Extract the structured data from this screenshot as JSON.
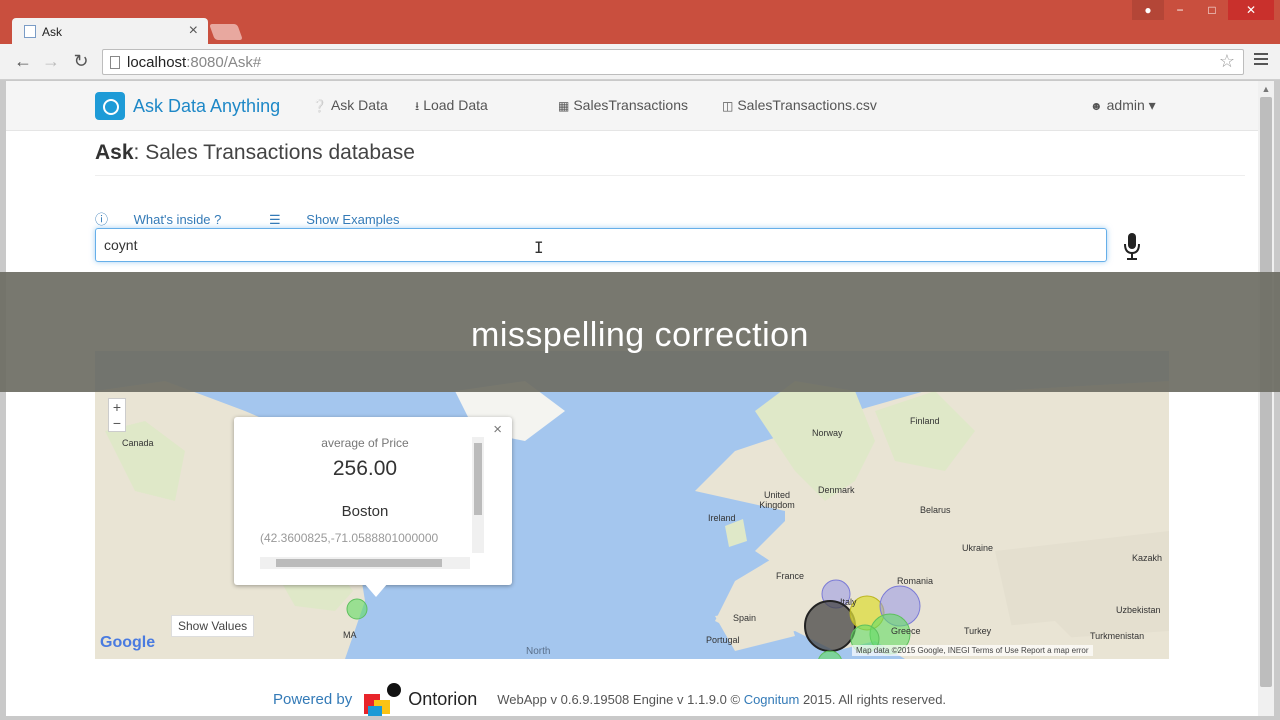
{
  "browser": {
    "tab_title": "Ask",
    "url_host": "localhost",
    "url_rest": ":8080/Ask#",
    "window_buttons": [
      "−",
      "□",
      "✕"
    ]
  },
  "app": {
    "brand": "Ask Data Anything",
    "nav": {
      "ask_data": "Ask Data",
      "load_data": "Load Data",
      "table": "SalesTransactions",
      "csv": "SalesTransactions.csv",
      "user": "admin"
    },
    "title_bold": "Ask",
    "title_rest": ": Sales Transactions database",
    "links": {
      "whats_inside": "What's inside ?",
      "show_examples": "Show Examples"
    },
    "query": "coynt"
  },
  "caption": "misspelling correction",
  "map": {
    "labels": {
      "canada": "Canada",
      "norway": "Norway",
      "finland": "Finland",
      "denmark": "Denmark",
      "uk": "United Kingdom",
      "ireland": "Ireland",
      "belarus": "Belarus",
      "ukraine": "Ukraine",
      "france": "France",
      "italy": "Italy",
      "spain": "Spain",
      "portugal": "Portugal",
      "romania": "Romania",
      "greece": "Greece",
      "turkey": "Turkey",
      "kazakh": "Kazakh",
      "uzbek": "Uzbekistan",
      "turkmen": "Turkmenistan",
      "ma": "MA",
      "north": "North"
    },
    "zoom_in": "+",
    "zoom_out": "−",
    "info": {
      "metric": "average of Price",
      "value": "256.00",
      "city": "Boston",
      "coords": "(42.3600825,-71.0588801000000"
    },
    "show_values": "Show Values",
    "google": "Google",
    "attribution": "Map data ©2015 Google, INEGI   Terms of Use   Report a map error"
  },
  "footer": {
    "powered_by": "Powered by",
    "company": "Ontorion",
    "version": "WebApp v 0.6.9.19508 Engine v 1.1.9.0 ©",
    "cognitum": "Cognitum",
    "rights": "2015. All rights reserved."
  }
}
